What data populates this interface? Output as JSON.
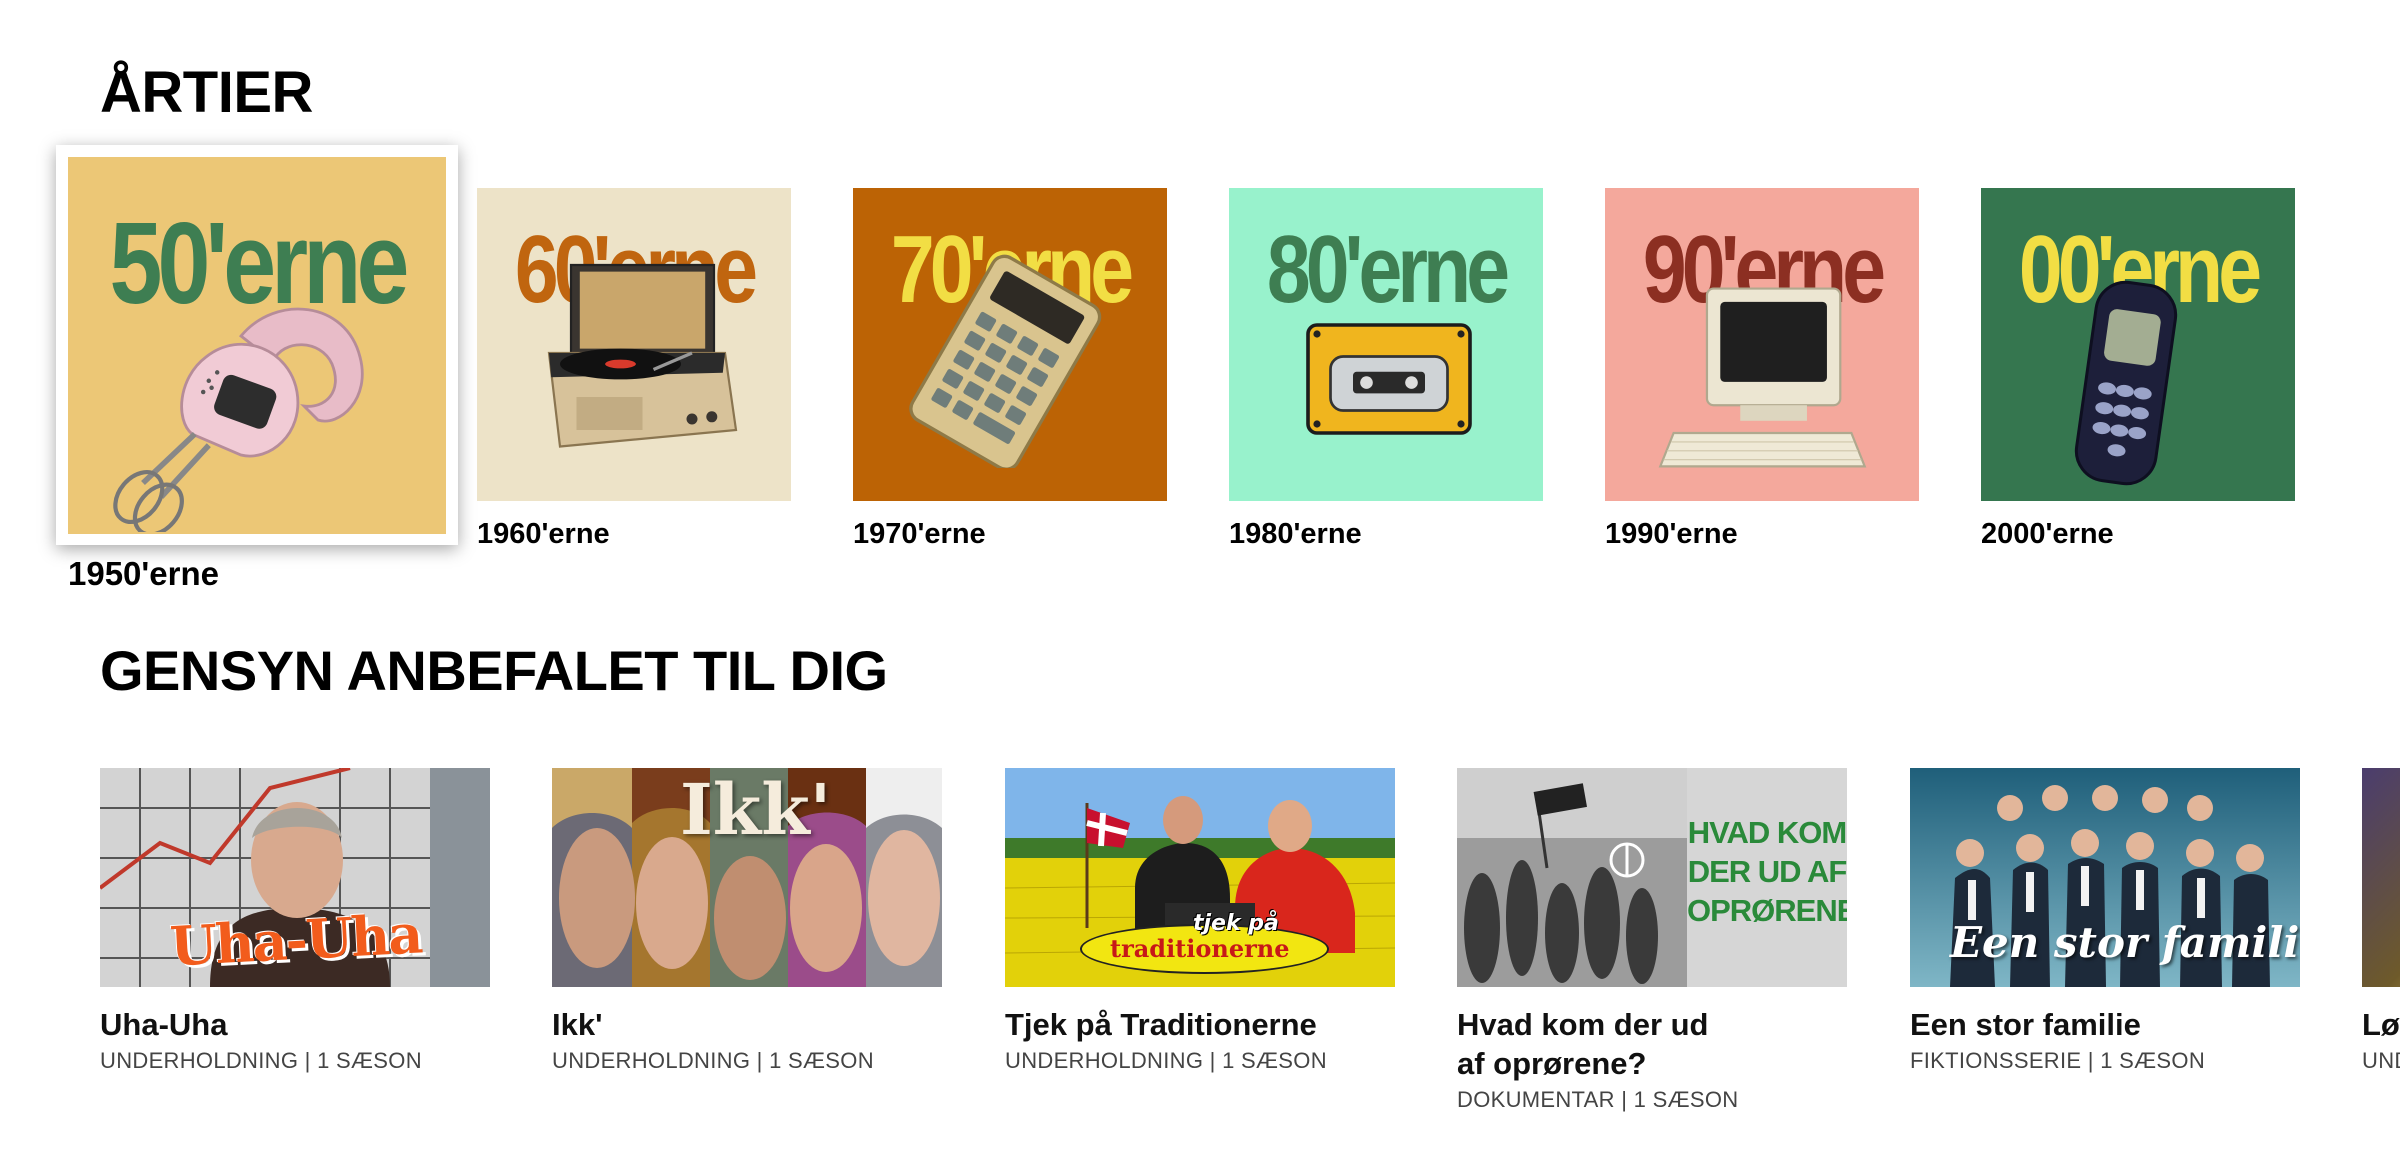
{
  "decades_section": {
    "title": "ÅRTIER",
    "items": [
      {
        "tile_text": "50'erne",
        "label": "1950'erne",
        "focused": true,
        "bg": "#ecc776",
        "text_color": "#3e7e52",
        "object": "hand-mixer-icon"
      },
      {
        "tile_text": "60'erne",
        "label": "1960'erne",
        "focused": false,
        "bg": "#ede3c8",
        "text_color": "#c0650f",
        "object": "record-player-icon"
      },
      {
        "tile_text": "70'erne",
        "label": "1970'erne",
        "focused": false,
        "bg": "#bc6305",
        "text_color": "#f2de44",
        "object": "calculator-icon"
      },
      {
        "tile_text": "80'erne",
        "label": "1980'erne",
        "focused": false,
        "bg": "#98f2cc",
        "text_color": "#3e7e52",
        "object": "cassette-player-icon"
      },
      {
        "tile_text": "90'erne",
        "label": "1990'erne",
        "focused": false,
        "bg": "#f4a89c",
        "text_color": "#8c2f22",
        "object": "desktop-computer-icon"
      },
      {
        "tile_text": "00'erne",
        "label": "2000'erne",
        "focused": false,
        "bg": "#35764f",
        "text_color": "#f2de44",
        "object": "mobile-phone-icon"
      }
    ]
  },
  "recommendations_section": {
    "title": "GENSYN ANBEFALET TIL DIG",
    "items": [
      {
        "title": "Uha-Uha",
        "meta": "UNDERHOLDNING | 1 SÆSON",
        "thumb_text": "Uha-Uha"
      },
      {
        "title": "Ikk'",
        "meta": "UNDERHOLDNING | 1 SÆSON",
        "thumb_text": "Ikk'"
      },
      {
        "title": "Tjek på Traditionerne",
        "meta": "UNDERHOLDNING | 1 SÆSON",
        "thumb_text_1": "tjek på",
        "thumb_text_2": "traditionerne"
      },
      {
        "title_line1": "Hvad kom der ud",
        "title_line2": "af oprørene?",
        "meta": "DOKUMENTAR | 1 SÆSON",
        "thumb_lines": [
          "HVAD KOM",
          "DER UD AF",
          "OPRØRENE?"
        ]
      },
      {
        "title": "Een stor familie",
        "meta": "FIKTIONSSERIE | 1 SÆSON",
        "thumb_text": "Een stor familie"
      },
      {
        "title": "Lø",
        "meta": "UND"
      }
    ]
  }
}
